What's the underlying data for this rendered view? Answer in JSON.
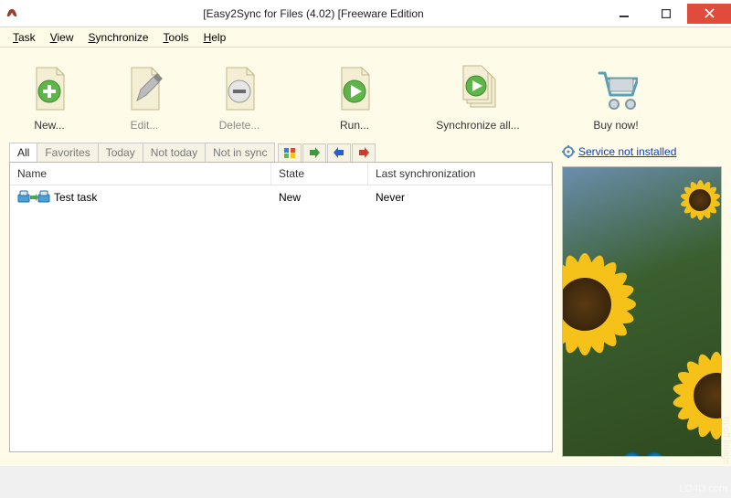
{
  "titlebar": {
    "title": "[Easy2Sync for Files (4.02) [Freeware Edition"
  },
  "menu": {
    "task": "Task",
    "task_u": "T",
    "view": "View",
    "view_u": "V",
    "synchronize": "Synchronize",
    "synchronize_u": "S",
    "tools": "Tools",
    "tools_u": "T",
    "help": "Help",
    "help_u": "H"
  },
  "toolbar": {
    "new_label": "New...",
    "edit_label": "Edit...",
    "delete_label": "Delete...",
    "run_label": "Run...",
    "sync_all_label": "Synchronize all...",
    "buy_label": "Buy now!"
  },
  "tabs": {
    "all": "All",
    "favorites": "Favorites",
    "today": "Today",
    "not_today": "Not today",
    "not_in_sync": "Not in sync"
  },
  "columns": {
    "name": "Name",
    "state": "State",
    "last_sync": "Last synchronization"
  },
  "rows": [
    {
      "name": "Test task",
      "state": "New",
      "last_sync": "Never"
    }
  ],
  "service_link": "Service not installed",
  "watermark": "LO4D.com",
  "side_text": "rn off image"
}
